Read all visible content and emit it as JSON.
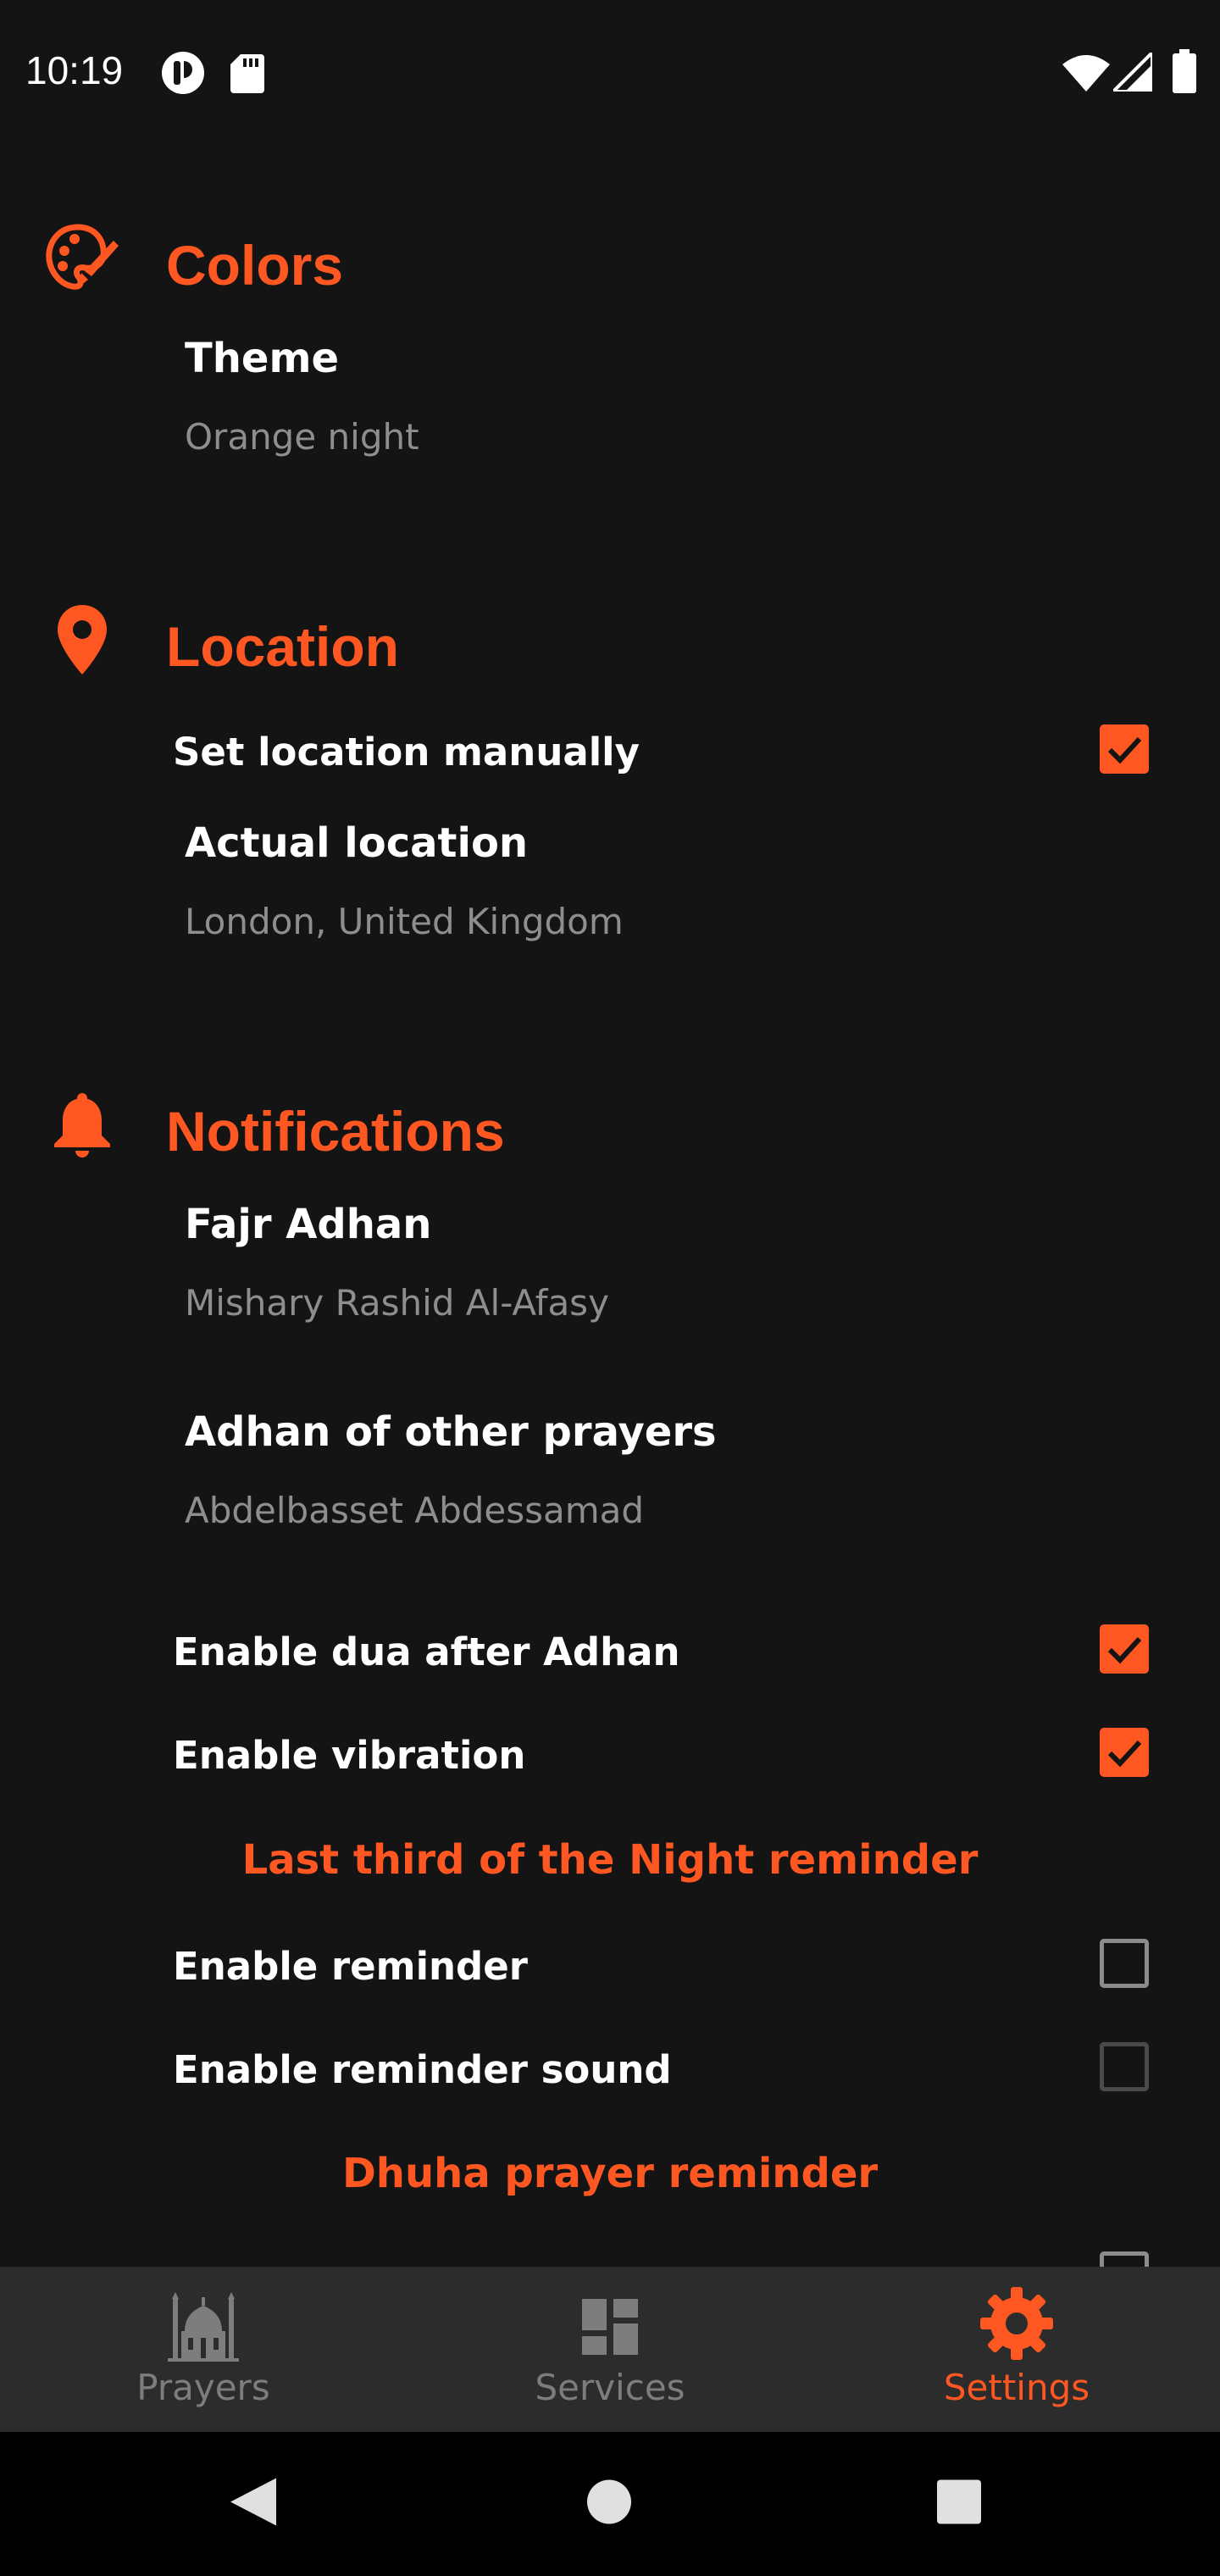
{
  "status_bar": {
    "time": "10:19",
    "icons": [
      "account-circle-icon",
      "sd-card-icon",
      "wifi-icon",
      "signal-icon",
      "battery-icon"
    ]
  },
  "colors": {
    "accent": "#ff5722",
    "background": "#141414",
    "summary_text": "#8e8e8e",
    "nav_background": "#2c2c2c"
  },
  "sections": {
    "colors": {
      "title": "Colors",
      "icon": "palette-icon",
      "theme": {
        "title": "Theme",
        "summary": "Orange night"
      }
    },
    "location": {
      "title": "Location",
      "icon": "map-pin-icon",
      "set_manually": {
        "label": "Set location manually",
        "checked": true
      },
      "actual_location": {
        "title": "Actual location",
        "summary": "London, United Kingdom"
      }
    },
    "notifications": {
      "title": "Notifications",
      "icon": "bell-icon",
      "fajr_adhan": {
        "title": "Fajr Adhan",
        "summary": "Mishary Rashid Al-Afasy"
      },
      "other_adhan": {
        "title": "Adhan of other prayers",
        "summary": "Abdelbasset Abdessamad"
      },
      "dua_after_adhan": {
        "label": "Enable dua after Adhan",
        "checked": true
      },
      "vibration": {
        "label": "Enable vibration",
        "checked": true
      },
      "last_third_heading": "Last third of the Night reminder",
      "enable_reminder": {
        "label": "Enable reminder",
        "checked": false
      },
      "enable_reminder_sound": {
        "label": "Enable reminder sound",
        "checked": false
      },
      "dhuha_heading": "Dhuha prayer reminder"
    }
  },
  "bottom_nav": {
    "items": [
      {
        "label": "Prayers",
        "icon": "mosque-icon",
        "active": false
      },
      {
        "label": "Services",
        "icon": "dashboard-icon",
        "active": false
      },
      {
        "label": "Settings",
        "icon": "gear-icon",
        "active": true
      }
    ]
  },
  "system_nav": {
    "buttons": [
      "back-icon",
      "home-icon",
      "recents-icon"
    ]
  }
}
